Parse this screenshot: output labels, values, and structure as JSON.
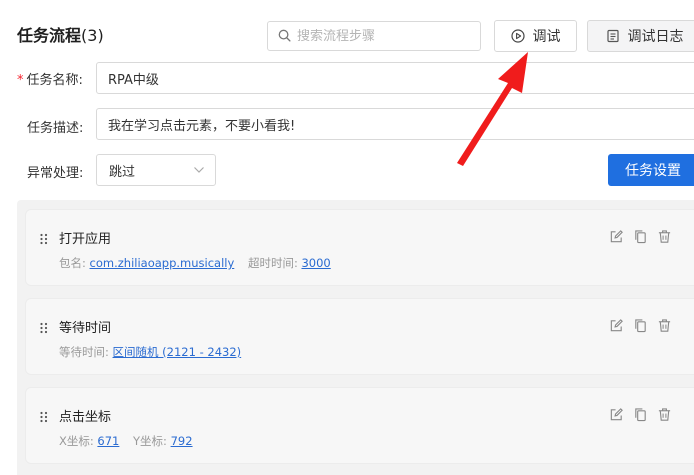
{
  "header": {
    "title": "任务流程",
    "count": "(3)",
    "search_placeholder": "搜索流程步骤",
    "debug_label": "调试",
    "log_label": "调试日志"
  },
  "form": {
    "name_label": "任务名称:",
    "name_value": "RPA中级",
    "desc_label": "任务描述:",
    "desc_value": "我在学习点击元素，不要小看我!",
    "error_label": "异常处理:",
    "error_value": "跳过",
    "settings_label": "任务设置"
  },
  "steps": [
    {
      "name": "打开应用",
      "meta": [
        {
          "label": "包名:",
          "value": "com.zhiliaoapp.musically"
        },
        {
          "label": "超时时间:",
          "value": "3000"
        }
      ]
    },
    {
      "name": "等待时间",
      "meta": [
        {
          "label": "等待时间:",
          "value": "区间随机 (2121 - 2432)"
        }
      ]
    },
    {
      "name": "点击坐标",
      "meta": [
        {
          "label": "X坐标:",
          "value": "671"
        },
        {
          "label": "Y坐标:",
          "value": "792"
        }
      ]
    }
  ],
  "icons": {
    "search": "search-icon",
    "debug": "play-circle-icon",
    "log": "log-icon",
    "drag": "drag-handle-icon",
    "edit": "edit-icon",
    "copy": "copy-icon",
    "delete": "trash-icon",
    "dropdown": "chevron-down-icon"
  },
  "colors": {
    "primary": "#1f6fe0",
    "link": "#2a6bd1",
    "required": "#f5222d",
    "arrow": "#f01c1c"
  }
}
